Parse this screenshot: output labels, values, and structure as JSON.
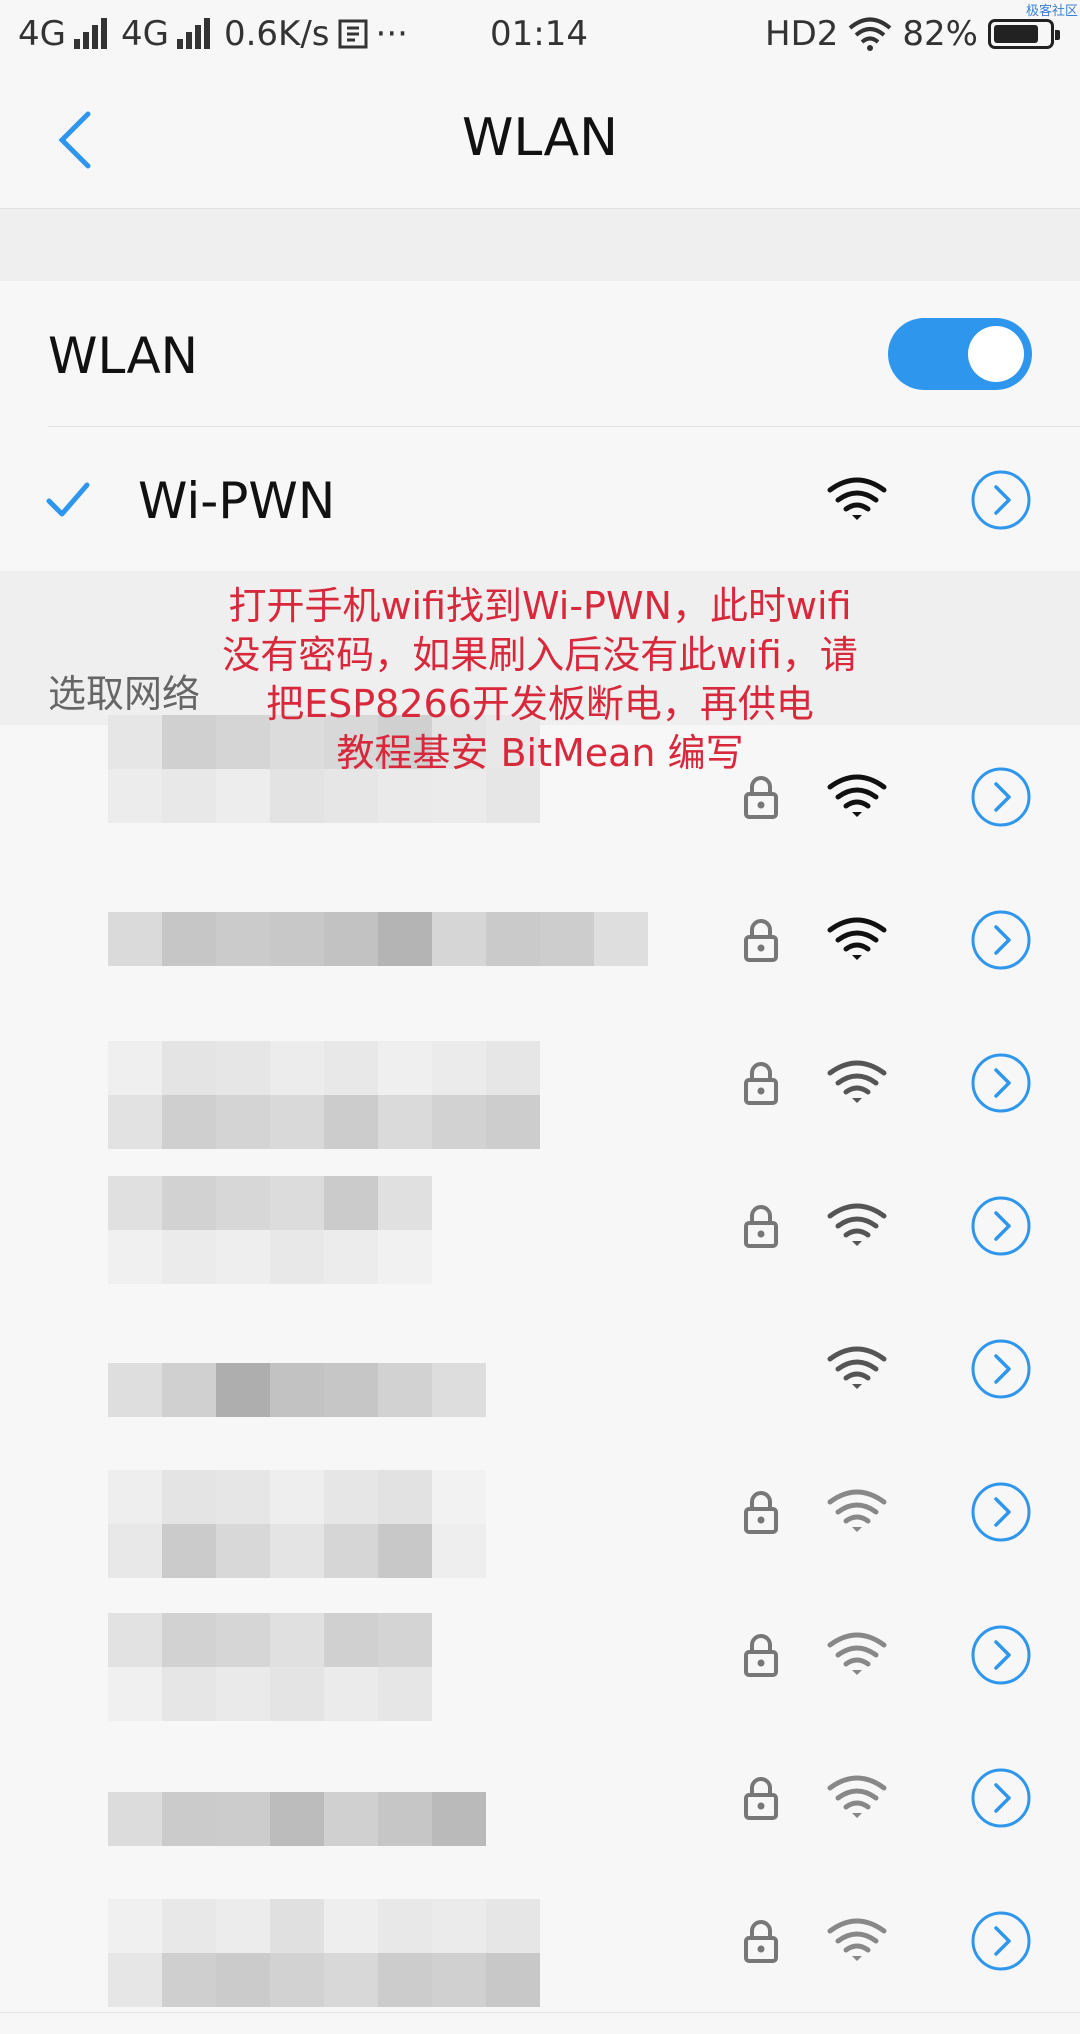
{
  "status_bar": {
    "network1": "4G",
    "network2": "4G",
    "speed": "0.6K/s",
    "extra": "···",
    "time": "01:14",
    "hd": "HD2",
    "battery": "82%",
    "battery_level": 0.82,
    "watermark": "极客社区"
  },
  "header": {
    "title": "WLAN"
  },
  "wlan_toggle": {
    "label": "WLAN",
    "on": true
  },
  "connected_network": {
    "name": "Wi-PWN",
    "wifi_strength": "strong",
    "locked": false
  },
  "section": {
    "label": "选取网络"
  },
  "annotation": {
    "lines": [
      "打开手机wifi找到Wi-PWN，此时wifi",
      "没有密码，如果刷入后没有此wifi，请",
      "把ESP8266开发板断电，再供电",
      "教程基安 BitMean 编写"
    ]
  },
  "networks": [
    {
      "locked": true,
      "signal": "strong"
    },
    {
      "locked": true,
      "signal": "strong"
    },
    {
      "locked": true,
      "signal": "medium"
    },
    {
      "locked": true,
      "signal": "medium"
    },
    {
      "locked": false,
      "signal": "medium"
    },
    {
      "locked": true,
      "signal": "weak"
    },
    {
      "locked": true,
      "signal": "weak"
    },
    {
      "locked": true,
      "signal": "weak"
    },
    {
      "locked": true,
      "signal": "weak"
    }
  ],
  "colors": {
    "accent": "#2f96ee",
    "annotation_text": "#d8283c",
    "wifi_strong": "#111111",
    "wifi_weak": "#888888"
  }
}
